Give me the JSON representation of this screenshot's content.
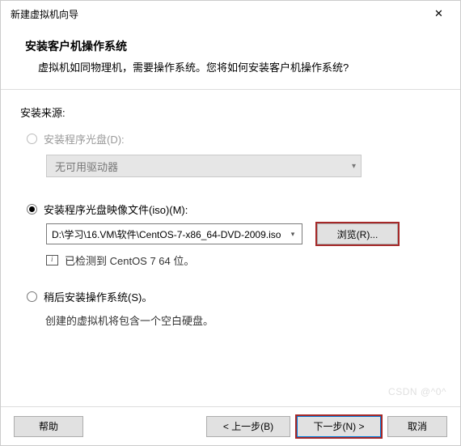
{
  "titlebar": {
    "title": "新建虚拟机向导",
    "close": "✕"
  },
  "header": {
    "title": "安装客户机操作系统",
    "subtitle": "虚拟机如同物理机，需要操作系统。您将如何安装客户机操作系统?"
  },
  "body": {
    "source_label": "安装来源:",
    "opt_disc": {
      "label": "安装程序光盘(D):",
      "dropdown": "无可用驱动器"
    },
    "opt_iso": {
      "label": "安装程序光盘映像文件(iso)(M):",
      "path": "D:\\学习\\16.VM\\软件\\CentOS-7-x86_64-DVD-2009.iso",
      "browse": "浏览(R)...",
      "detected": "已检测到 CentOS 7 64 位。"
    },
    "opt_later": {
      "label": "稍后安装操作系统(S)。",
      "note": "创建的虚拟机将包含一个空白硬盘。"
    }
  },
  "footer": {
    "help": "帮助",
    "back": "< 上一步(B)",
    "next": "下一步(N) >",
    "cancel": "取消"
  },
  "watermark": "CSDN @^0^"
}
